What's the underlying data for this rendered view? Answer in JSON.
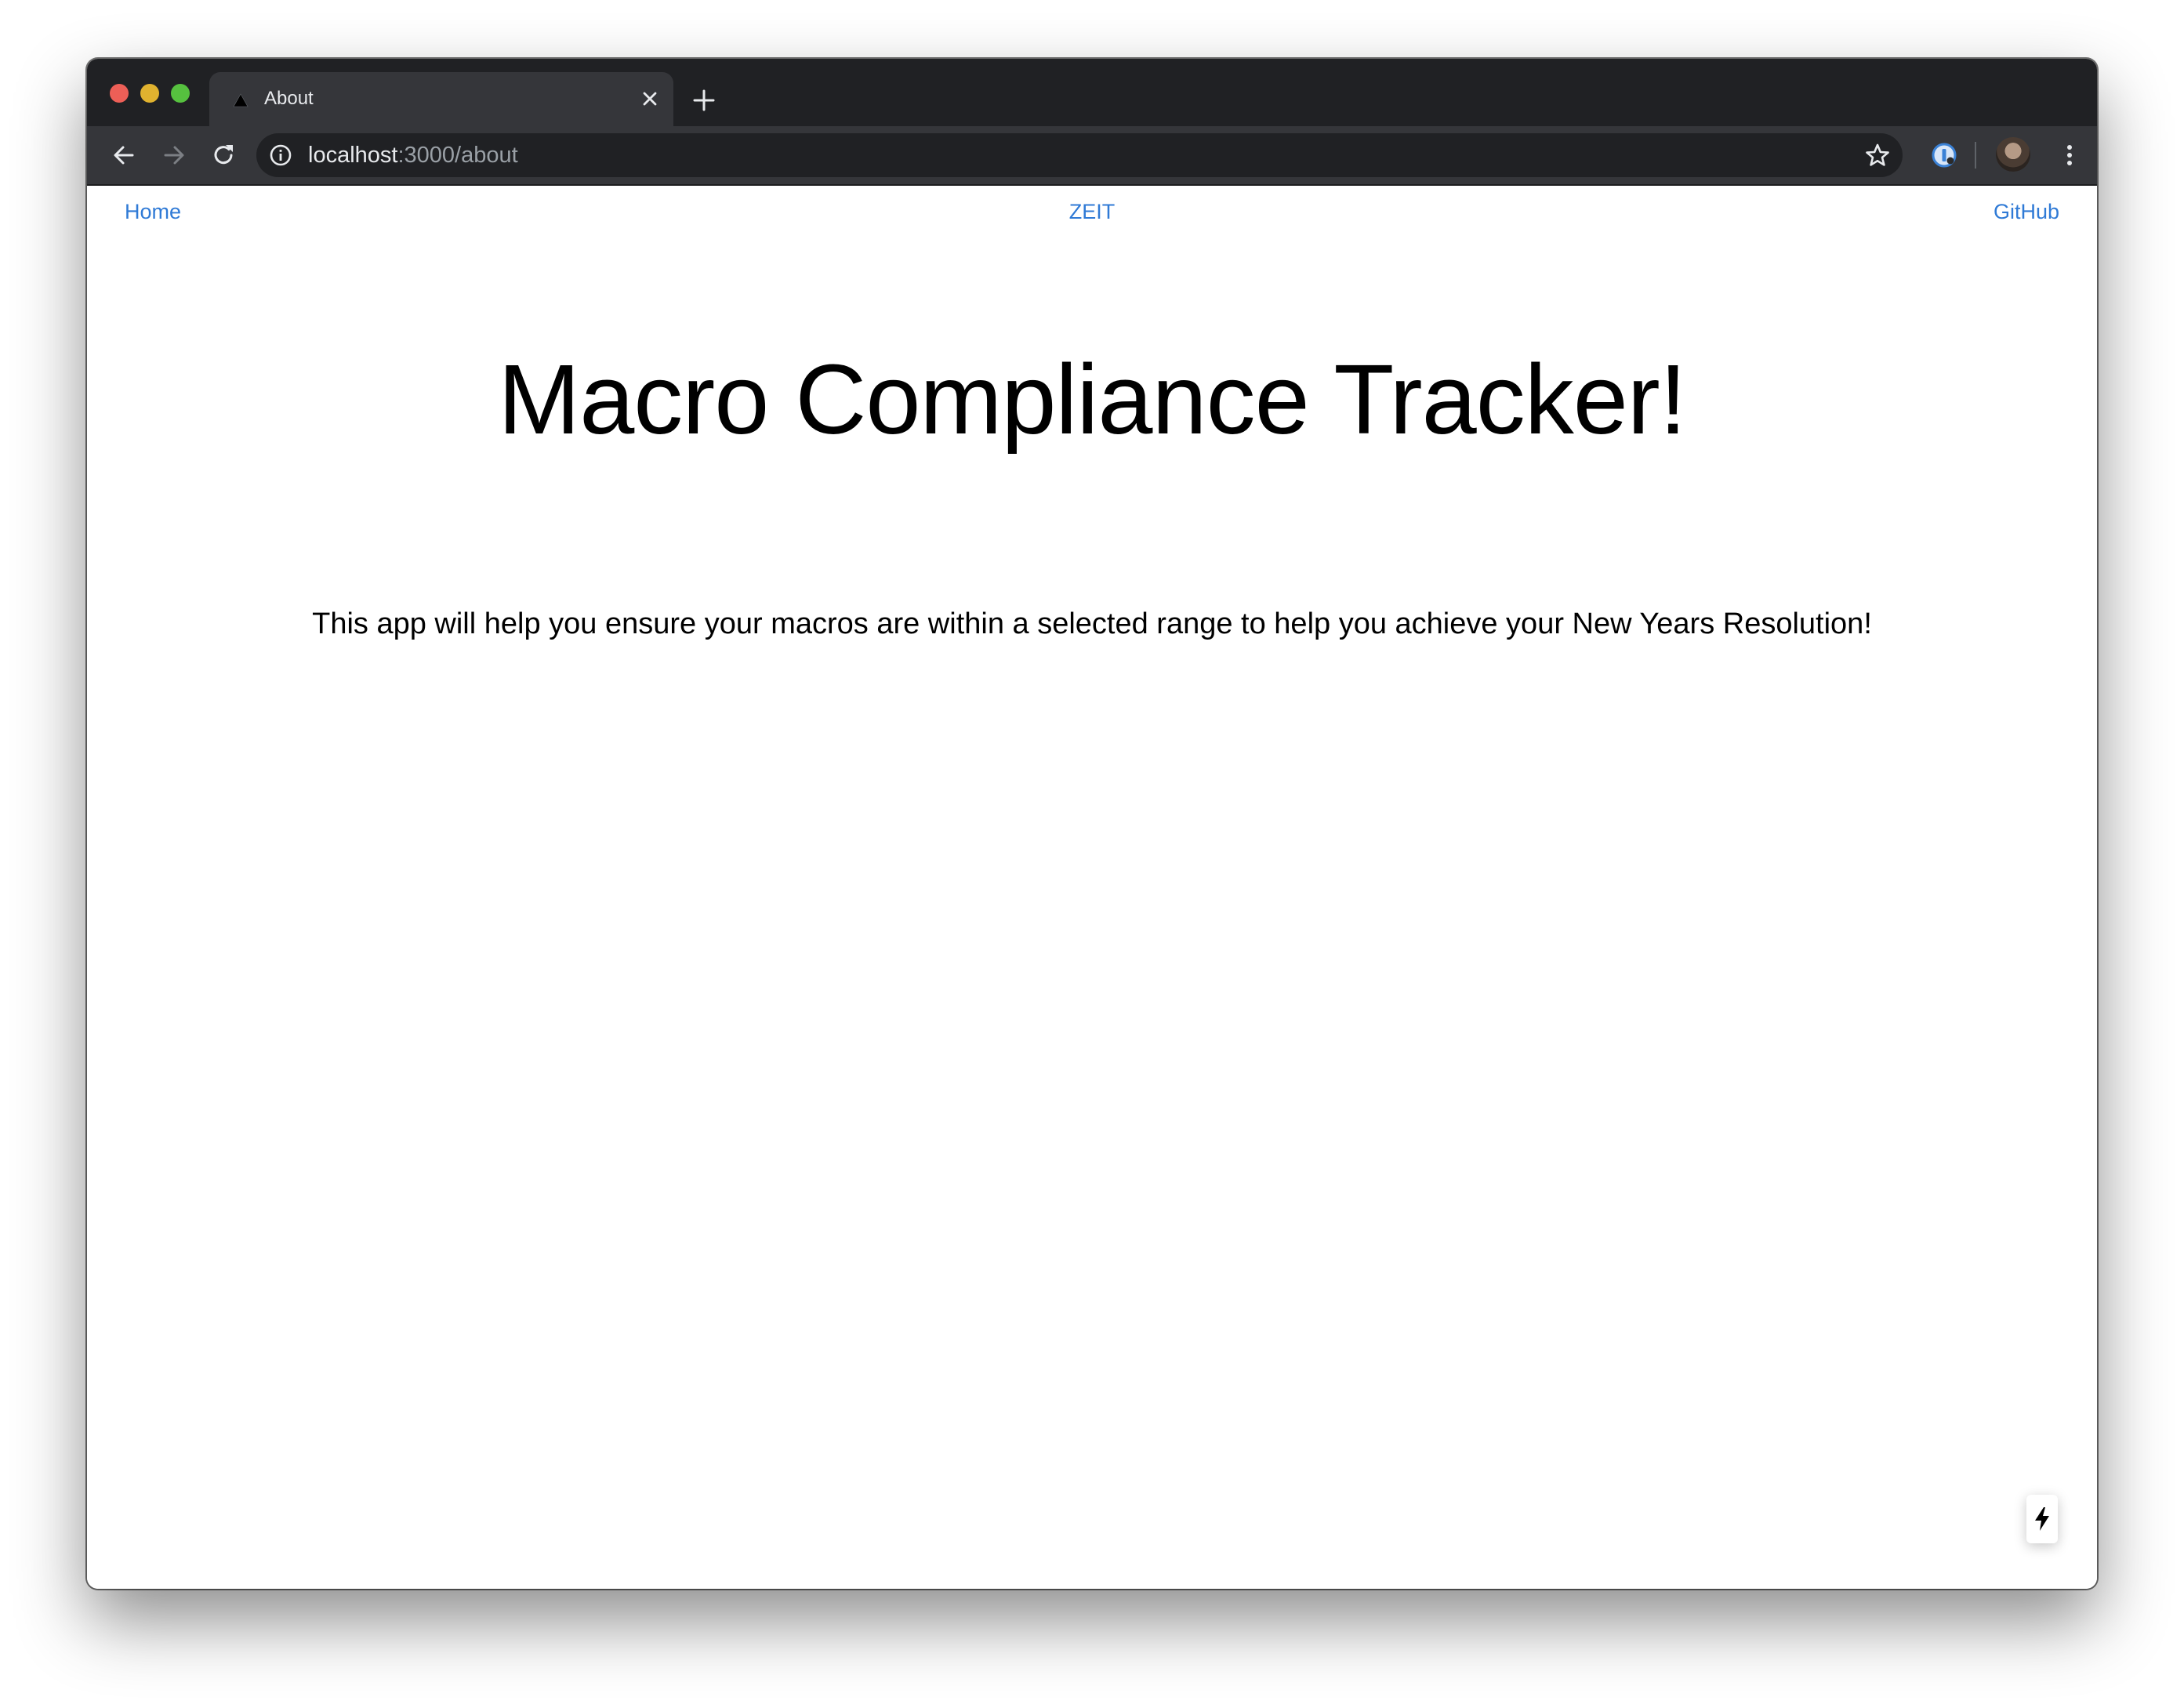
{
  "browser": {
    "tab": {
      "title": "About",
      "favicon": "triangle-icon"
    },
    "address_bar": {
      "host": "localhost",
      "path": ":3000/about"
    },
    "icons": {
      "back": "arrow-left-icon",
      "forward": "arrow-right-icon",
      "reload": "reload-icon",
      "info": "info-icon",
      "bookmark": "star-icon",
      "extension": "password-manager-icon",
      "profile": "avatar",
      "menu": "more-vert-icon",
      "new_tab": "plus-icon",
      "close_tab": "close-icon"
    }
  },
  "nav": {
    "home": "Home",
    "zeit": "ZEIT",
    "github": "GitHub",
    "link_color": "#2f7ad6"
  },
  "hero": {
    "title": "Macro Compliance Tracker!",
    "description": "This app will help you ensure your macros are within a selected range to help you achieve your New Years Resolution!"
  },
  "badge": {
    "icon": "lightning-icon"
  },
  "colors": {
    "tabstrip": "#202124",
    "toolbar": "#35363a",
    "close": "#ed5f57",
    "minimize": "#e0b22f",
    "zoom": "#56c13f"
  }
}
